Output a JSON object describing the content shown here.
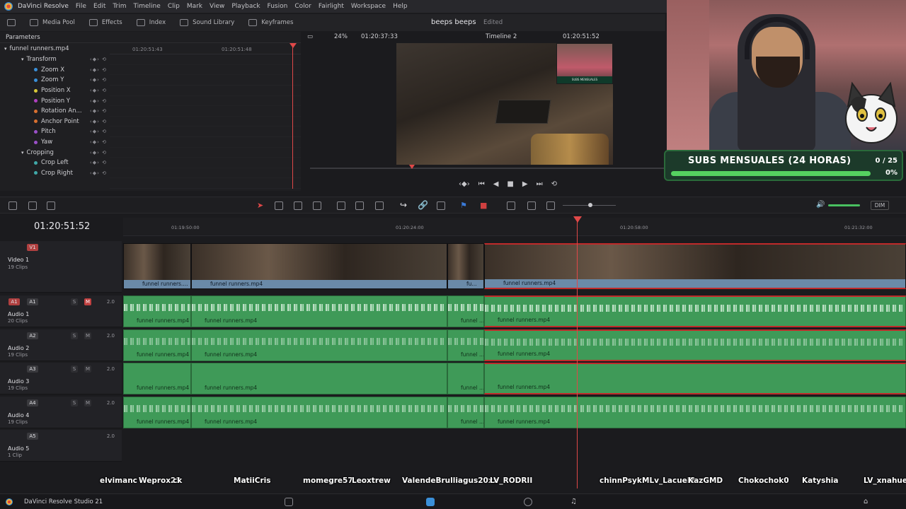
{
  "app": {
    "name": "DaVinci Resolve",
    "menu": [
      "File",
      "Edit",
      "Trim",
      "Timeline",
      "Clip",
      "Mark",
      "View",
      "Playback",
      "Fusion",
      "Color",
      "Fairlight",
      "Workspace",
      "Help"
    ]
  },
  "toolbar": {
    "media_pool": "Media Pool",
    "effects": "Effects",
    "index": "Index",
    "sound_library": "Sound Library",
    "keyframes": "Keyframes",
    "project_title": "beeps beeps",
    "project_status": "Edited"
  },
  "inspector": {
    "header": "Parameters",
    "clip_name": "funnel runners.mp4",
    "ruler": [
      "01:20:51:43",
      "01:20:51:48"
    ],
    "params": [
      {
        "label": "Transform",
        "color": "",
        "group": true
      },
      {
        "label": "Zoom X",
        "color": "#3a8fd8"
      },
      {
        "label": "Zoom Y",
        "color": "#3a8fd8"
      },
      {
        "label": "Position X",
        "color": "#d8c838"
      },
      {
        "label": "Position Y",
        "color": "#b040c0"
      },
      {
        "label": "Rotation An...",
        "color": "#d87030"
      },
      {
        "label": "Anchor Point",
        "color": "#d87030"
      },
      {
        "label": "Pitch",
        "color": "#9a50c8"
      },
      {
        "label": "Yaw",
        "color": "#9a50c8"
      },
      {
        "label": "Cropping",
        "color": "",
        "group": true
      },
      {
        "label": "Crop Left",
        "color": "#40a8a8"
      },
      {
        "label": "Crop Right",
        "color": "#40a8a8"
      }
    ]
  },
  "viewer": {
    "zoom": "24%",
    "source_timecode": "01:20:37:33",
    "timeline_name": "Timeline 2",
    "record_timecode": "01:20:51:52",
    "cam_caption": "SUBS MENSUALES"
  },
  "subs_widget": {
    "title": "SUBS MENSUALES (24 HORAS)",
    "count": "0 / 25",
    "percent": "0%",
    "progress": 0
  },
  "timeline": {
    "timecode": "01:20:51:52",
    "ruler": [
      "01:19:50:00",
      "01:20:24:00",
      "01:20:58:00",
      "01:21:32:00"
    ],
    "dim_label": "DIM",
    "tracks": [
      {
        "id": "V1",
        "name": "Video 1",
        "clips": "19 Clips"
      },
      {
        "id": "A1",
        "name": "Audio 1",
        "clips": "20 Clips",
        "vol": "2.0",
        "muted": true
      },
      {
        "id": "A2",
        "name": "Audio 2",
        "clips": "19 Clips",
        "vol": "2.0"
      },
      {
        "id": "A3",
        "name": "Audio 3",
        "clips": "19 Clips",
        "vol": "2.0"
      },
      {
        "id": "A4",
        "name": "Audio 4",
        "clips": "19 Clips",
        "vol": "2.0"
      },
      {
        "id": "A5",
        "name": "Audio 5",
        "clips": "1 Clip",
        "vol": "2.0"
      }
    ],
    "clip_labels": {
      "v1": [
        "funnel runners....",
        "funnel runners.mp4",
        "fu...",
        "funnel runners.mp4"
      ],
      "audio": [
        "funnel runners.mp4",
        "funnel runners.mp4",
        "funnel ...",
        "funnel runners.mp4"
      ]
    },
    "solo_label": "S",
    "mute_label": "M"
  },
  "chat": [
    "elvimanc",
    "Weprox23",
    "ck",
    "MatiiCris",
    "momegre57",
    "Leoxtrew",
    "ValendeBrulliagus20xx",
    "LV_RODRII",
    "chinnPsyk",
    "MLv_Lacuel7",
    "KazGMD",
    "Chokochok0",
    "Katyshia",
    "LV_xnahuel"
  ],
  "footer": {
    "brand": "DaVinci Resolve Studio 21"
  }
}
